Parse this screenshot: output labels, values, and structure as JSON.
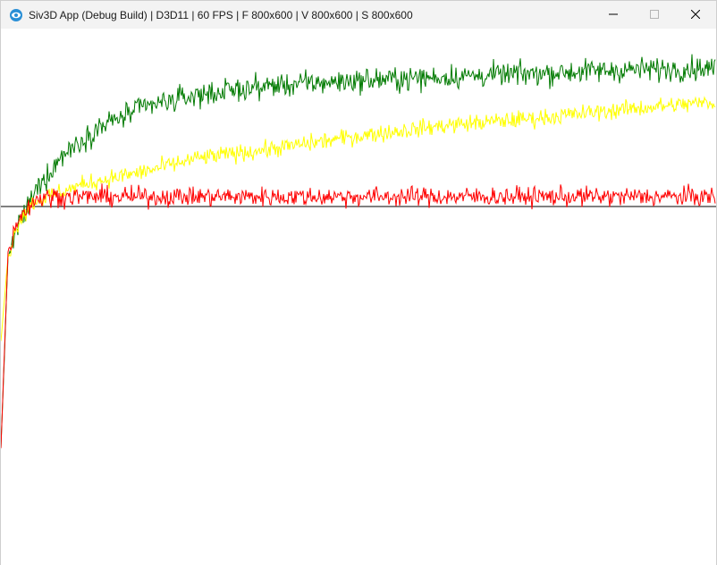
{
  "window": {
    "title": "Siv3D App (Debug Build) | D3D11 | 60 FPS | F 800x600 | V 800x600 | S 800x600",
    "app_icon": "siv3d-logo-icon",
    "controls": {
      "minimize_icon": "minimize-icon",
      "maximize_icon": "maximize-icon",
      "close_icon": "close-icon"
    }
  },
  "chart_data": {
    "type": "line",
    "samples": 800,
    "grid": false,
    "legend": "none",
    "axes_visible": false,
    "ylim": [
      0,
      600
    ],
    "reference_line": {
      "y": 401,
      "color": "#000000"
    },
    "series": [
      {
        "color": "#007a00",
        "start_y": 130,
        "rise": [
          [
            0,
            130
          ],
          [
            8,
            345
          ],
          [
            20,
            380
          ],
          [
            40,
            420
          ],
          [
            70,
            460
          ],
          [
            110,
            490
          ],
          [
            160,
            512
          ],
          [
            220,
            526
          ],
          [
            300,
            536
          ],
          [
            400,
            542
          ],
          [
            500,
            546
          ],
          [
            600,
            550
          ],
          [
            700,
            554
          ],
          [
            799,
            556
          ]
        ],
        "noise": 11
      },
      {
        "color": "#ffff00",
        "start_y": 250,
        "rise": [
          [
            0,
            250
          ],
          [
            8,
            345
          ],
          [
            20,
            385
          ],
          [
            35,
            405
          ],
          [
            60,
            415
          ],
          [
            100,
            428
          ],
          [
            160,
            440
          ],
          [
            220,
            455
          ],
          [
            300,
            465
          ],
          [
            400,
            480
          ],
          [
            500,
            492
          ],
          [
            600,
            500
          ],
          [
            700,
            510
          ],
          [
            799,
            518
          ]
        ],
        "noise": 8
      },
      {
        "color": "#ff0000",
        "start_y": 130,
        "rise": [
          [
            0,
            130
          ],
          [
            8,
            350
          ],
          [
            20,
            390
          ],
          [
            40,
            410
          ],
          [
            60,
            412
          ],
          [
            799,
            412
          ]
        ],
        "noise": 9
      }
    ]
  }
}
